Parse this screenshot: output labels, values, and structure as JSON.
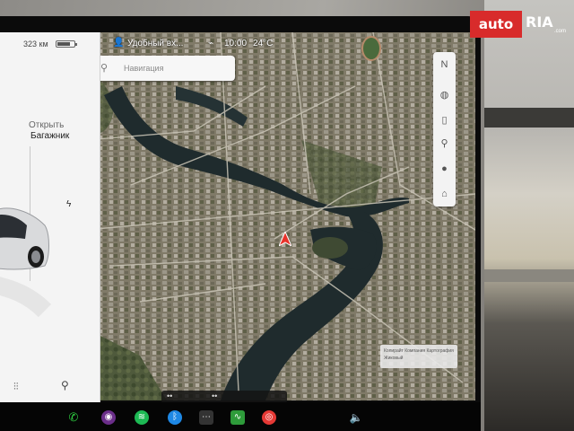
{
  "status": {
    "range": "323 км",
    "profile": "Удобный вх...",
    "time": "10:00",
    "temperature": "24°C"
  },
  "car_panel": {
    "trunk_action": "Открыть",
    "trunk_label": "Багажник"
  },
  "navigation": {
    "placeholder": "Навигация"
  },
  "attribution": "Копирайт Компания Картография Жиковый",
  "watermark": {
    "brand": "auto",
    "brand2": "RIA",
    "domain": ".com"
  },
  "colors": {
    "map_water": "#1d2a2c",
    "accent_red": "#d82b2b",
    "spotify_green": "#1db954",
    "bluetooth_blue": "#1e88e5"
  }
}
